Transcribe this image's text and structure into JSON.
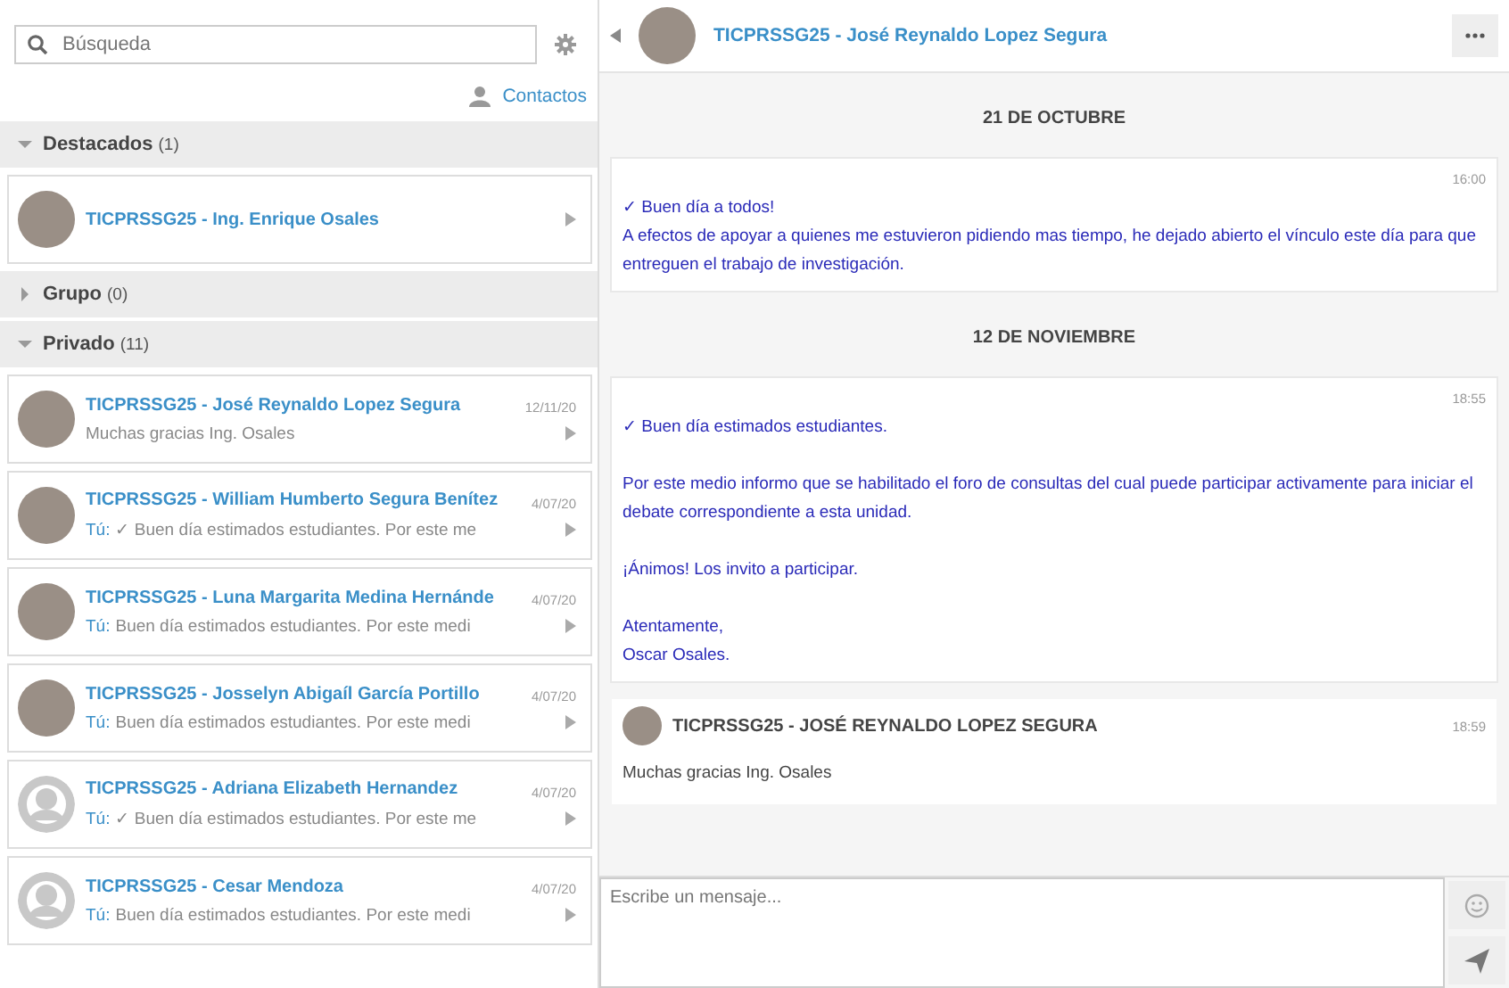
{
  "sidebar": {
    "search": {
      "placeholder": "Búsqueda"
    },
    "contacts_link": "Contactos",
    "sections": [
      {
        "title": "Destacados",
        "count": "(1)",
        "expanded": true,
        "conversations": [
          {
            "name": "TICPRSSG25 - Ing. Enrique Osales",
            "has_photo": true
          }
        ]
      },
      {
        "title": "Grupo",
        "count": "(0)",
        "expanded": false
      },
      {
        "title": "Privado",
        "count": "(11)",
        "expanded": true,
        "conversations": [
          {
            "name": "TICPRSSG25 - José Reynaldo Lopez Segura",
            "date": "12/11/20",
            "preview": "Muchas gracias Ing. Osales",
            "has_photo": true
          },
          {
            "name": "TICPRSSG25 - William Humberto Segura Benítez",
            "date": "4/07/20",
            "prefix": "Tú:",
            "preview": "✓ Buen día estimados estudiantes. Por este me",
            "has_photo": true
          },
          {
            "name": "TICPRSSG25 - Luna Margarita Medina Hernánde",
            "date": "4/07/20",
            "prefix": "Tú:",
            "preview": "Buen día estimados estudiantes. Por este medi",
            "has_photo": true
          },
          {
            "name": "TICPRSSG25 - Josselyn Abigaíl García Portillo",
            "date": "4/07/20",
            "prefix": "Tú:",
            "preview": "Buen día estimados estudiantes. Por este medi",
            "has_photo": true
          },
          {
            "name": "TICPRSSG25 - Adriana Elizabeth Hernandez",
            "date": "4/07/20",
            "prefix": "Tú:",
            "preview": "✓ Buen día estimados estudiantes. Por este me",
            "has_photo": false
          },
          {
            "name": "TICPRSSG25 - Cesar Mendoza",
            "date": "4/07/20",
            "prefix": "Tú:",
            "preview": "Buen día estimados estudiantes. Por este medi",
            "has_photo": false
          }
        ]
      }
    ]
  },
  "chat": {
    "title": "TICPRSSG25 - José Reynaldo Lopez Segura",
    "messages": [
      {
        "kind": "date",
        "text": "21 DE OCTUBRE"
      },
      {
        "kind": "sent",
        "time": "16:00",
        "paragraphs": [
          [
            "✓ Buen día a todos!",
            "A efectos de apoyar a quienes me estuvieron pidiendo mas tiempo, he dejado abierto el vínculo este día para que entreguen el trabajo de investigación."
          ]
        ]
      },
      {
        "kind": "date",
        "text": "12 DE NOVIEMBRE"
      },
      {
        "kind": "sent",
        "time": "18:55",
        "paragraphs": [
          [
            "✓ Buen día estimados estudiantes."
          ],
          [
            "Por este medio informo que se habilitado el foro de consultas del cual puede participar activamente para iniciar el debate correspondiente a esta unidad."
          ],
          [
            "¡Ánimos! Los invito a participar."
          ],
          [
            "Atentamente,",
            "Oscar Osales."
          ]
        ]
      },
      {
        "kind": "received",
        "sender": "TICPRSSG25 - JOSÉ REYNALDO LOPEZ SEGURA",
        "time": "18:59",
        "text": "Muchas gracias Ing. Osales"
      }
    ],
    "composer": {
      "placeholder": "Escribe un mensaje..."
    }
  }
}
